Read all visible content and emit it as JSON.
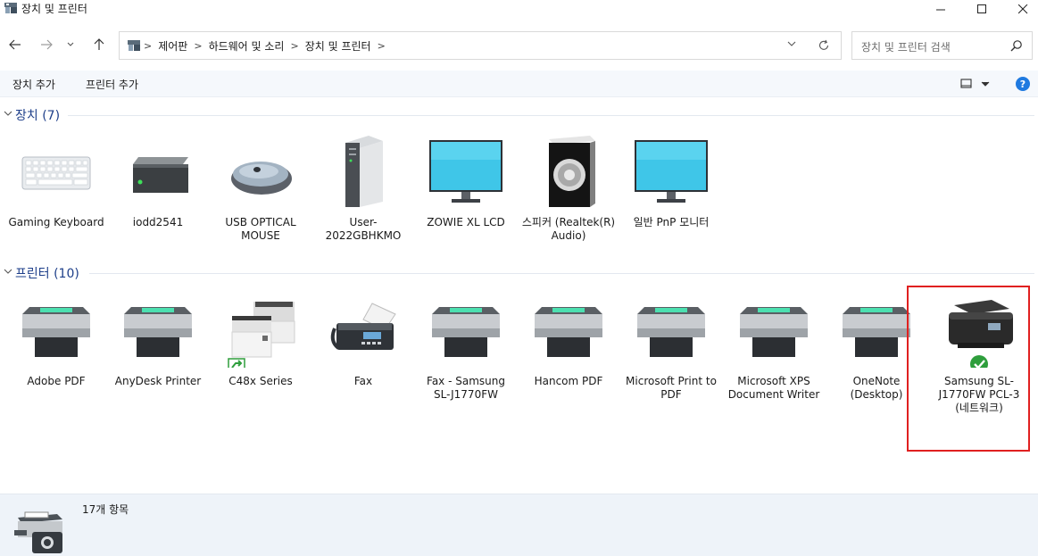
{
  "window": {
    "title": "장치 및 프린터",
    "minimize_glyph": "—",
    "maximize_glyph": "☐",
    "close_glyph": "✕"
  },
  "nav": {
    "back_icon": "arrow-left-icon",
    "forward_icon": "arrow-right-icon",
    "recent_icon": "chevron-down-icon",
    "up_icon": "arrow-up-icon",
    "breadcrumbs": [
      "제어판",
      "하드웨어 및 소리",
      "장치 및 프린터"
    ],
    "search_placeholder": "장치 및 프린터 검색"
  },
  "commandbar": {
    "add_device": "장치 추가",
    "add_printer": "프린터 추가",
    "help": "?"
  },
  "groups": {
    "devices": {
      "title": "장치 (7)",
      "items": [
        {
          "label": "Gaming Keyboard",
          "icon": "keyboard-icon"
        },
        {
          "label": "iodd2541",
          "icon": "external-drive-icon"
        },
        {
          "label": "USB OPTICAL MOUSE",
          "icon": "mouse-icon"
        },
        {
          "label": "User-2022GBHKMO",
          "icon": "computer-tower-icon"
        },
        {
          "label": "ZOWIE XL LCD",
          "icon": "monitor-icon"
        },
        {
          "label": "스피커 (Realtek(R) Audio)",
          "icon": "speaker-icon"
        },
        {
          "label": "일반 PnP 모니터",
          "icon": "monitor-icon"
        }
      ]
    },
    "printers": {
      "title": "프린터 (10)",
      "items": [
        {
          "label": "Adobe PDF",
          "icon": "printer-icon"
        },
        {
          "label": "AnyDesk Printer",
          "icon": "printer-icon"
        },
        {
          "label": "C48x Series",
          "icon": "laser-printer-icon"
        },
        {
          "label": "Fax",
          "icon": "fax-icon"
        },
        {
          "label": "Fax - Samsung SL-J1770FW",
          "icon": "printer-icon"
        },
        {
          "label": "Hancom PDF",
          "icon": "printer-icon"
        },
        {
          "label": "Microsoft Print to PDF",
          "icon": "printer-icon"
        },
        {
          "label": "Microsoft XPS Document Writer",
          "icon": "printer-icon"
        },
        {
          "label": "OneNote (Desktop)",
          "icon": "printer-icon"
        },
        {
          "label": "Samsung SL-J1770FW PCL-3 (네트워크)",
          "icon": "inkjet-printer-icon"
        }
      ]
    }
  },
  "details": {
    "count": "17개 항목"
  },
  "colors": {
    "accent": "#1f7ae0",
    "group_title": "#1e3f8a",
    "highlight": "#e02020",
    "default_check": "#2e9e3c"
  }
}
